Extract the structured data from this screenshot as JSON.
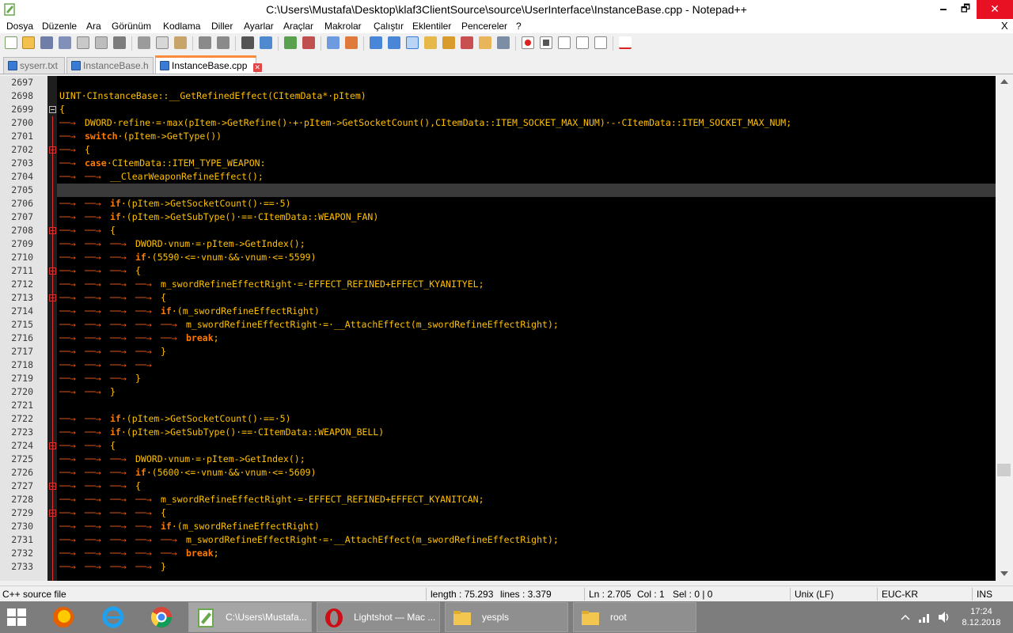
{
  "window": {
    "title": "C:\\Users\\Mustafa\\Desktop\\klaf3ClientSource\\source\\UserInterface\\InstanceBase.cpp - Notepad++",
    "minimize": "🗕",
    "maximize": "🗗",
    "close": "✕"
  },
  "menu": {
    "items": [
      "Dosya",
      "Düzenle",
      "Ara",
      "Görünüm",
      "Kodlama",
      "Diller",
      "Ayarlar",
      "Araçlar",
      "Makrolar",
      "Çalıştır",
      "Eklentiler",
      "Pencereler",
      "?"
    ],
    "close_doc": "X"
  },
  "tabs": [
    {
      "label": "syserr.txt",
      "active": false
    },
    {
      "label": "InstanceBase.h",
      "active": false
    },
    {
      "label": "InstanceBase.cpp",
      "active": true
    }
  ],
  "editor": {
    "line_numbers": [
      "2697",
      "2698",
      "2699",
      "2700",
      "2701",
      "2702",
      "2703",
      "2704",
      "2705",
      "2706",
      "2707",
      "2708",
      "2709",
      "2710",
      "2711",
      "2712",
      "2713",
      "2714",
      "2715",
      "2716",
      "2717",
      "2718",
      "2719",
      "2720",
      "2721",
      "2722",
      "2723",
      "2724",
      "2725",
      "2726",
      "2727",
      "2728",
      "2729",
      "2730",
      "2731",
      "2732",
      "2733"
    ],
    "lines": [
      "",
      "UINT·CInstanceBase::__GetRefinedEffect(CItemData*·pItem)",
      "{",
      "→DWORD·refine·=·max(pItem->GetRefine()·+·pItem->GetSocketCount(),CItemData::ITEM_SOCKET_MAX_NUM)·-·CItemData::ITEM_SOCKET_MAX_NUM;",
      "→switch·(pItem->GetType())",
      "→{",
      "→case·CItemData::ITEM_TYPE_WEAPON:",
      "→→__ClearWeaponRefineEffect();",
      "",
      "→→if·(pItem->GetSocketCount()·==·5)",
      "→→if·(pItem->GetSubType()·==·CItemData::WEAPON_FAN)",
      "→→{",
      "→→→DWORD·vnum·=·pItem->GetIndex();",
      "→→→if·(5590·<=·vnum·&&·vnum·<=·5599)",
      "→→→{",
      "→→→→m_swordRefineEffectRight·=·EFFECT_REFINED+EFFECT_KYANITYEL;",
      "→→→→{",
      "→→→→if·(m_swordRefineEffectRight)",
      "→→→→→m_swordRefineEffectRight·=·__AttachEffect(m_swordRefineEffectRight);",
      "→→→→→break;",
      "→→→→}",
      "→→→→",
      "→→→}",
      "→→}",
      "",
      "→→if·(pItem->GetSocketCount()·==·5)",
      "→→if·(pItem->GetSubType()·==·CItemData::WEAPON_BELL)",
      "→→{",
      "→→→DWORD·vnum·=·pItem->GetIndex();",
      "→→→if·(5600·<=·vnum·&&·vnum·<=·5609)",
      "→→→{",
      "→→→→m_swordRefineEffectRight·=·EFFECT_REFINED+EFFECT_KYANITCAN;",
      "→→→→{",
      "→→→→if·(m_swordRefineEffectRight)",
      "→→→→→m_swordRefineEffectRight·=·__AttachEffect(m_swordRefineEffectRight);",
      "→→→→→break;",
      "→→→→}"
    ],
    "current_line_index": 8
  },
  "status": {
    "filetype": "C++ source file",
    "length": "length : 75.293",
    "lines": "lines : 3.379",
    "ln": "Ln : 2.705",
    "col": "Col : 1",
    "sel": "Sel : 0 | 0",
    "eol": "Unix (LF)",
    "encoding": "EUC-KR",
    "mode": "INS"
  },
  "taskbar": {
    "tasks": [
      {
        "label": "C:\\Users\\Mustafa...",
        "active": true
      },
      {
        "label": "Lightshot — Mac ...",
        "active": false
      },
      {
        "label": "yespls",
        "active": false
      },
      {
        "label": "root",
        "active": false
      }
    ],
    "time": "17:24",
    "date": "8.12.2018"
  },
  "colors": {
    "editor_bg": "#000000",
    "keyword": "#ff7a00",
    "identifier": "#ffc000",
    "tab_accent": "#fa8a3c",
    "close_red": "#e81123"
  }
}
